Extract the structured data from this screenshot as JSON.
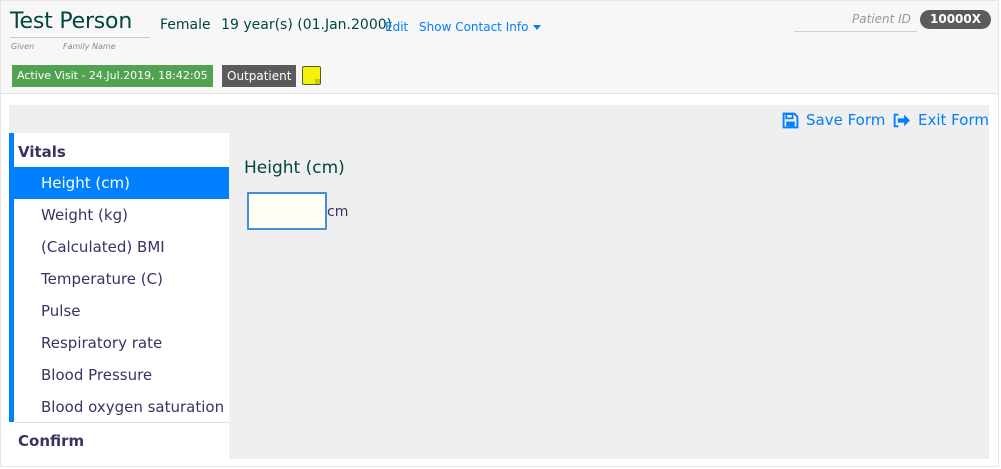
{
  "patient": {
    "given_name": "Test",
    "family_name": "Person",
    "given_label": "Given",
    "family_label": "Family Name",
    "gender": "Female",
    "age_dob": "19 year(s) (01.Jan.2000)",
    "edit_label": "Edit",
    "contact_label": "Show Contact Info",
    "id_label": "Patient ID",
    "id_value": "10000X"
  },
  "visit": {
    "status": "Active Visit - 24.Jul.2019, 18:42:05",
    "type": "Outpatient"
  },
  "toolbar": {
    "save_label": "Save Form",
    "exit_label": "Exit Form"
  },
  "sidebar": {
    "section_vitals": "Vitals",
    "items": [
      {
        "label": "Height (cm)",
        "active": true
      },
      {
        "label": "Weight (kg)",
        "active": false
      },
      {
        "label": "(Calculated) BMI",
        "active": false
      },
      {
        "label": "Temperature (C)",
        "active": false
      },
      {
        "label": "Pulse",
        "active": false
      },
      {
        "label": "Respiratory rate",
        "active": false
      },
      {
        "label": "Blood Pressure",
        "active": false
      },
      {
        "label": "Blood oxygen saturation",
        "active": false
      }
    ],
    "section_confirm": "Confirm"
  },
  "question": {
    "label": "Height (cm)",
    "value": "",
    "unit": "cm"
  },
  "colors": {
    "accent": "#007fff",
    "name": "#00463f",
    "visit_badge": "#51a351",
    "dark_badge": "#5b5b5b",
    "sticky_note": "#f2f20b"
  }
}
